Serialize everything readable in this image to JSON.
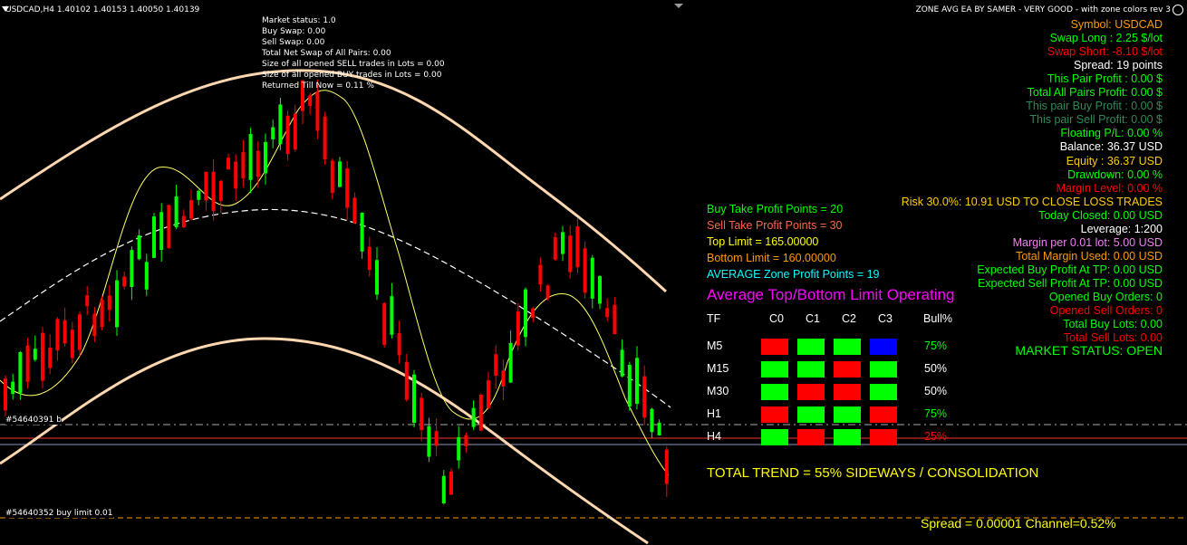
{
  "header": {
    "symbol_info": "USDCAD,H4 1.40102 1.40153 1.40050 1.40139",
    "ea_title": "ZONE AVG EA BY SAMER - VERY GOOD - with zone colors rev 3"
  },
  "info_block": [
    "Market status: 1.0",
    "Buy Swap: 0.00",
    "Sell Swap: 0.00",
    "Total Net Swap of All Pairs: 0.00",
    "Size of all opened SELL trades in Lots = 0.00",
    "Size of all opened BUY trades in Lots = 0.00",
    "Returned Till Now = 0.11  %"
  ],
  "right_stats": [
    {
      "text": "Symbol: USDCAD",
      "color": "#ff9900"
    },
    {
      "text": "Swap Long : 2.25 $/lot",
      "color": "#00ff00"
    },
    {
      "text": "Swap Short: -8.10 $/lot",
      "color": "#ff0000"
    },
    {
      "text": "Spread: 19 points",
      "color": "#ffffff"
    },
    {
      "text": "This Pair Profit : 0.00 $",
      "color": "#00ff00"
    },
    {
      "text": "Total All Pairs Profit: 0.00 $",
      "color": "#00ff00"
    },
    {
      "text": "This pair Buy Profit : 0.00 $",
      "color": "#2e8b57"
    },
    {
      "text": "This pair Sell Profit: 0.00 $",
      "color": "#2e8b57"
    },
    {
      "text": "Floating P/L: 0.00 %",
      "color": "#00ff00"
    },
    {
      "text": "Balance: 36.37 USD",
      "color": "#ffffff"
    },
    {
      "text": "Equity : 36.37 USD",
      "color": "#ffcc00"
    },
    {
      "text": "Drawdown: 0.00 %",
      "color": "#00ff00"
    },
    {
      "text": "Margin Level: 0.00 %",
      "color": "#ff0000"
    },
    {
      "text": "Risk 30.0%: 10.91 USD TO CLOSE LOSS TRADES",
      "color": "#ffcc00"
    },
    {
      "text": "Today Closed: 0.00 USD",
      "color": "#00ff00"
    },
    {
      "text": "Leverage: 1:200",
      "color": "#ffffff"
    },
    {
      "text": "Margin per 0.01 lot: 5.00 USD",
      "color": "#ee82ee"
    },
    {
      "text": "Total Margin Used: 0.00 USD",
      "color": "#ff9900"
    },
    {
      "text": "Expected Buy Profit At TP: 0.00 USD",
      "color": "#00ff00"
    },
    {
      "text": "Expected Sell Profit At TP: 0.00 USD",
      "color": "#00ff00"
    },
    {
      "text": "Opened Buy Orders: 0",
      "color": "#00ff00"
    },
    {
      "text": "Opened Sell Orders: 0",
      "color": "#ff0000"
    },
    {
      "text": "Total Buy Lots: 0.00",
      "color": "#00ff00"
    },
    {
      "text": "Total Sell Lots: 0.00",
      "color": "#ff0000"
    }
  ],
  "market_status": "MARKET STATUS: OPEN",
  "mid_settings": [
    {
      "text": "Buy Take Profit Points = 20",
      "color": "#00ff00"
    },
    {
      "text": "Sell Take Profit Points = 30",
      "color": "#ff6347"
    },
    {
      "text": "Top Limit = 165.00000",
      "color": "#ffff00"
    },
    {
      "text": "Bottom Limit = 160.00000",
      "color": "#ff9900"
    },
    {
      "text": "AVERAGE Zone Profit Points = 19",
      "color": "#00ffff"
    }
  ],
  "avg_title": "Average Top/Bottom Limit Operating",
  "table": {
    "headers": [
      "TF",
      "C0",
      "C1",
      "C2",
      "C3",
      "Bull%"
    ],
    "rows": [
      {
        "tf": "M5",
        "cells": [
          "#ff0000",
          "#00ff00",
          "#00ff00",
          "#0000ff"
        ],
        "bull": "75%",
        "bull_color": "#00ff00"
      },
      {
        "tf": "M15",
        "cells": [
          "#00ff00",
          "#00ff00",
          "#ff0000",
          "#00ff00"
        ],
        "bull": "50%",
        "bull_color": "#ffffff"
      },
      {
        "tf": "M30",
        "cells": [
          "#00ff00",
          "#ff0000",
          "#ff0000",
          "#00ff00"
        ],
        "bull": "50%",
        "bull_color": "#ffffff"
      },
      {
        "tf": "H1",
        "cells": [
          "#ff0000",
          "#00ff00",
          "#00ff00",
          "#ff0000"
        ],
        "bull": "75%",
        "bull_color": "#00ff00"
      },
      {
        "tf": "H4",
        "cells": [
          "#00ff00",
          "#ff0000",
          "#00ff00",
          "#ff0000"
        ],
        "bull": "25%",
        "bull_color": "#ff0000"
      }
    ]
  },
  "total_trend": "TOTAL TREND = 55%  SIDEWAYS / CONSOLIDATION",
  "spread_channel": "Spread  =  0.00001    Channel=0.52%",
  "order_labels": {
    "order1": "#54640391 b",
    "order2": "#54640352 buy limit 0.01"
  },
  "colors": {
    "bull_candle": "#00ff00",
    "bear_candle": "#ff0000",
    "channel": "#ffd7b0",
    "ma_fast": "#ffff66",
    "ma_slow": "#ffffff"
  }
}
